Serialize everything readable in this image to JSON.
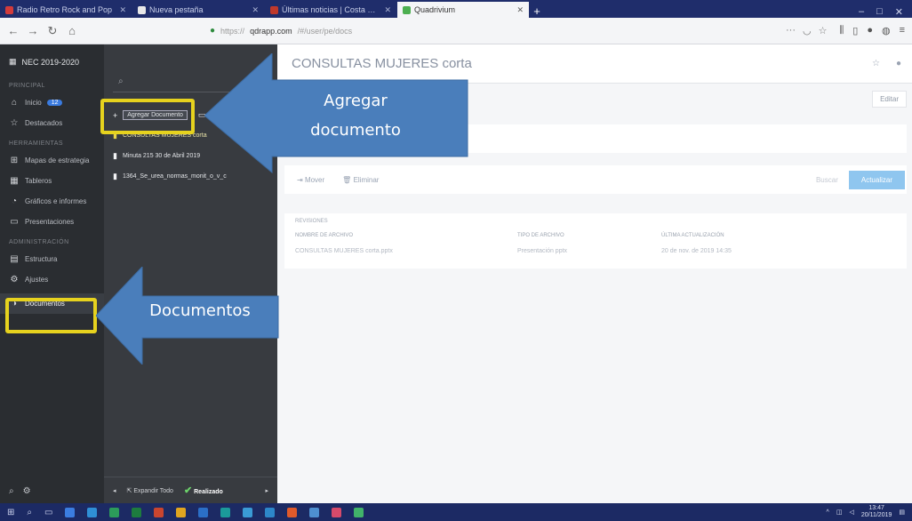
{
  "browser": {
    "tabs": [
      {
        "label": "Radio Retro Rock and Pop",
        "color": "#d23b3b",
        "active": false
      },
      {
        "label": "Nueva pestaña",
        "color": "#e8e8e8",
        "active": false
      },
      {
        "label": "Últimas noticias | Costa Rica",
        "color": "#c0392b",
        "active": false
      },
      {
        "label": "Quadrivium",
        "color": "#4caf50",
        "active": true
      }
    ],
    "url_prefix": "https://",
    "url_domain": "qdrapp.com",
    "url_rest": "/#/user/pe/docs"
  },
  "sidebar": {
    "workspace": "NEC 2019-2020",
    "section1": "Principal",
    "items1": [
      {
        "label": "Inicio",
        "icon": "home-icon",
        "glyph": "⌂",
        "badge": "12"
      },
      {
        "label": "Destacados",
        "icon": "star-icon",
        "glyph": "☆"
      }
    ],
    "section2": "Herramientas",
    "items2": [
      {
        "label": "Mapas de estrategia",
        "icon": "map-icon",
        "glyph": "⊞"
      },
      {
        "label": "Tableros",
        "icon": "board-icon",
        "glyph": "▦"
      },
      {
        "label": "Gráficos e informes",
        "icon": "chart-icon",
        "glyph": "◔"
      },
      {
        "label": "Presentaciones",
        "icon": "presentation-icon",
        "glyph": "▭"
      }
    ],
    "section3": "Administración",
    "items3": [
      {
        "label": "Estructura",
        "icon": "structure-icon",
        "glyph": "▤"
      },
      {
        "label": "Ajustes",
        "icon": "settings-icon",
        "glyph": "⚙"
      }
    ],
    "documents": "Documentos"
  },
  "docpanel": {
    "search_icon": "search-icon",
    "add_document": "Agregar Documento",
    "files": [
      "CONSULTAS MUJERES corta",
      "Minuta 215 30 de Abril 2019",
      "1364_Se_urea_normas_monit_o_v_c"
    ],
    "expand_all": "Expandir Todo",
    "done": "Realizado"
  },
  "main": {
    "title": "CONSULTAS MUJERES corta",
    "edit": "Editar",
    "move": "Mover",
    "delete": "Eliminar",
    "search": "Buscar",
    "upload": "Actualizar",
    "revisions_title": "Revisiones",
    "col_name": "Nombre de archivo",
    "col_type": "Tipo de archivo",
    "col_updated": "Última actualización",
    "row_name": "CONSULTAS MUJERES corta.pptx",
    "row_type": "Presentación pptx",
    "row_updated": "20 de nov. de 2019 14:35"
  },
  "annotations": {
    "add_callout": "Agregar documento",
    "docs_callout": "Documentos",
    "arrow_color": "#4a7ebb",
    "highlight_color": "#e6d21e"
  },
  "taskbar": {
    "time": "13:47",
    "date": "20/11/2019"
  }
}
